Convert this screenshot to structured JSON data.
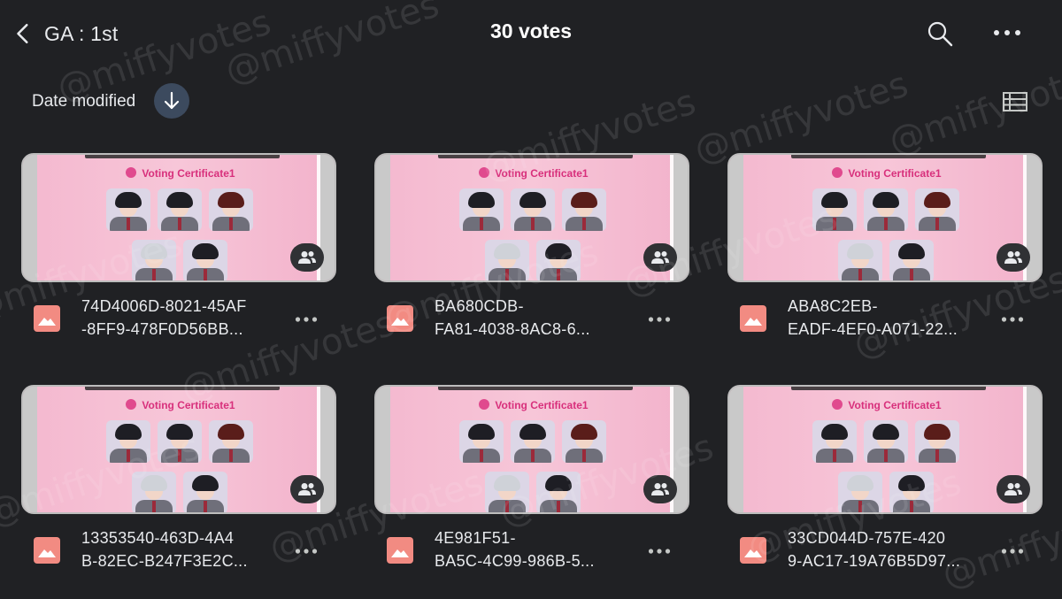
{
  "header": {
    "back_label": "GA : 1st",
    "title": "30 votes"
  },
  "sort": {
    "label": "Date modified",
    "direction": "descending"
  },
  "thumbnail": {
    "certificate_title": "Voting Certificate1"
  },
  "files": [
    {
      "line1": "74D4006D-8021-45AF",
      "line2": "-8FF9-478F0D56BB..."
    },
    {
      "line1": "BA680CDB-",
      "line2": "FA81-4038-8AC8-6..."
    },
    {
      "line1": "ABA8C2EB-",
      "line2": "EADF-4EF0-A071-22..."
    },
    {
      "line1": "13353540-463D-4A4",
      "line2": "B-82EC-B247F3E2C..."
    },
    {
      "line1": "4E981F51-",
      "line2": "BA5C-4C99-986B-5..."
    },
    {
      "line1": "33CD044D-757E-420",
      "line2": "9-AC17-19A76B5D97..."
    }
  ],
  "watermark": "@miffyvotes",
  "colors": {
    "background": "#202124",
    "text": "#e8eaed",
    "image_icon": "#f28b82",
    "sort_button": "#3c4a5e",
    "certificate_pink": "#f7c6d8",
    "certificate_title": "#d8307c"
  },
  "icons": {
    "back": "chevron-left-icon",
    "search": "search-icon",
    "more": "more-horiz-icon",
    "sort": "arrow-down-icon",
    "list_view": "list-view-icon",
    "shared": "people-icon",
    "file_type": "image-icon"
  }
}
